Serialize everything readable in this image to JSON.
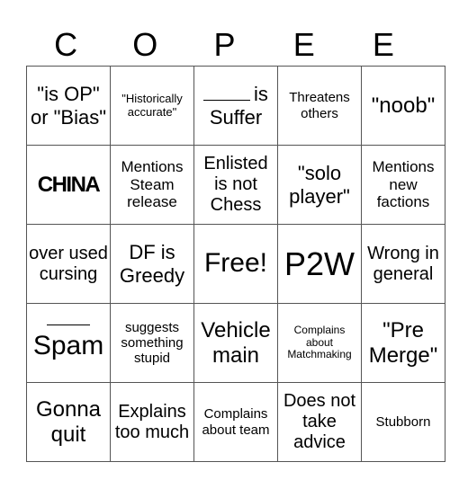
{
  "title_letters": [
    "C",
    "O",
    "P",
    "E",
    "E"
  ],
  "cells": [
    [
      "\"is OP\" or \"Bias\"",
      "\"Historically accurate\"",
      "is Suffer",
      "Threatens others",
      "\"noob\""
    ],
    [
      "CHINA",
      "Mentions Steam release",
      "Enlisted is not Chess",
      "\"solo player\"",
      "Mentions new factions"
    ],
    [
      "over used cursing",
      "DF is Greedy",
      "Free!",
      "P2W",
      "Wrong in general"
    ],
    [
      "Spam",
      "suggests something stupid",
      "Vehicle main",
      "Complains about Matchmaking",
      "\"Pre Merge\""
    ],
    [
      "Gonna quit",
      "Explains too much",
      "Complains about team",
      "Does not take advice",
      "Stubborn"
    ]
  ]
}
